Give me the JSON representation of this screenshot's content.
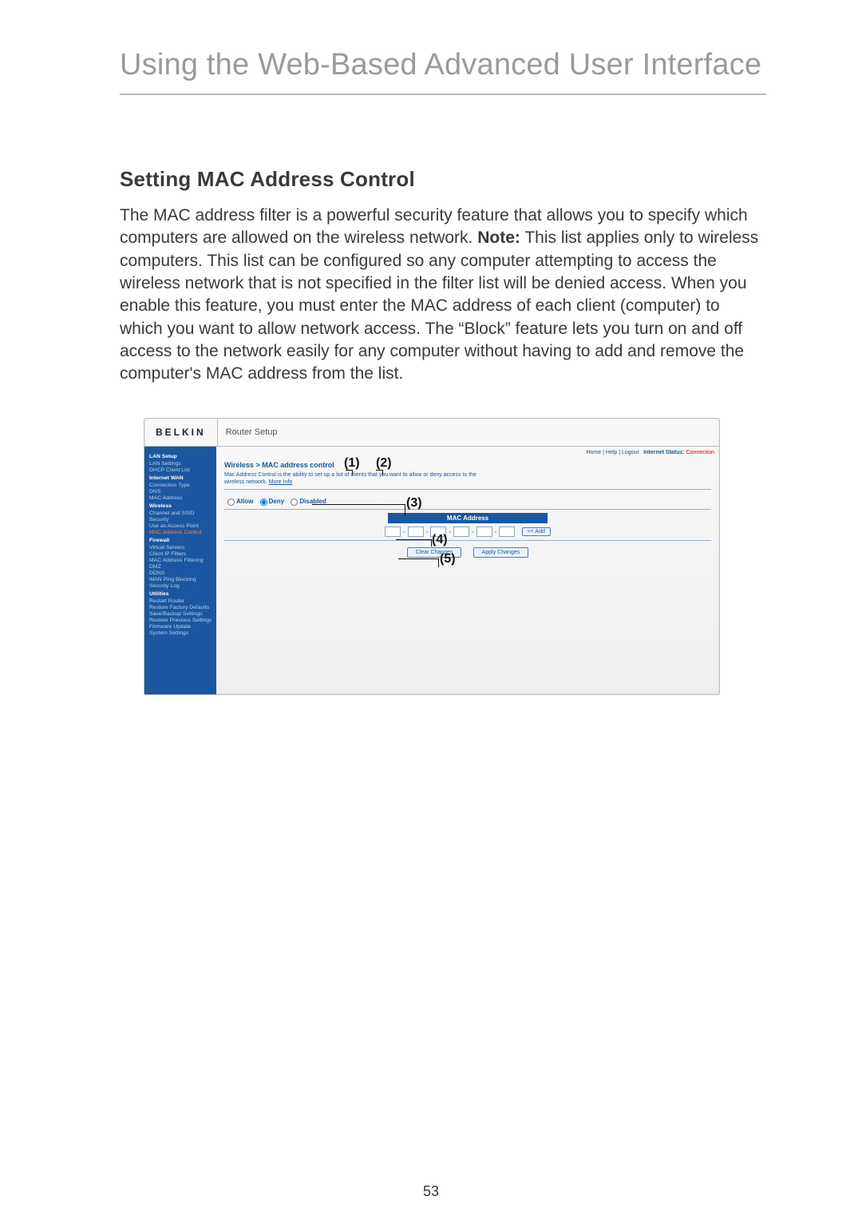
{
  "page": {
    "title": "Using the Web-Based Advanced User Interface",
    "section_title": "Setting MAC Address Control",
    "body_p1a": "The MAC address filter is a powerful security feature that allows you to specify which computers are allowed on the wireless network. ",
    "body_note_label": "Note:",
    "body_p1b": " This list applies only to wireless computers. This list can be configured so any computer attempting to access the wireless network that is not specified in the filter list will be denied access. When you enable this feature, you must enter the MAC address of each client (computer) to which you want to allow network access. The “Block” feature lets you turn on and off access to the network easily for any computer without having to add and remove the computer's MAC address from the list.",
    "number": "53"
  },
  "callouts": {
    "c1": "(1)",
    "c2": "(2)",
    "c3": "(3)",
    "c4": "(4)",
    "c5": "(5)"
  },
  "ui": {
    "logo": "BELKIN",
    "brand": "Router Setup",
    "toplinks": {
      "home": "Home",
      "help": "Help",
      "logout": "Logout",
      "status_label": "Internet Status:",
      "status_value": "Connection"
    },
    "sidebar": {
      "g1": "LAN Setup",
      "g1_items": [
        "LAN Settings",
        "DHCP Client List"
      ],
      "g2": "Internet WAN",
      "g2_items": [
        "Connection Type",
        "DNS",
        "MAC Address"
      ],
      "g3": "Wireless",
      "g3_items": [
        "Channel and SSID",
        "Security",
        "Use as Access Point"
      ],
      "g3_sel": "MAC Address Control",
      "g4": "Firewall",
      "g4_items": [
        "Virtual Servers",
        "Client IP Filters",
        "MAC Address Filtering",
        "DMZ",
        "DDNS",
        "WAN Ping Blocking",
        "Security Log"
      ],
      "g5": "Utilities",
      "g5_items": [
        "Restart Router",
        "Restore Factory Defaults",
        "Save/Backup Settings",
        "Restore Previous Settings",
        "Firmware Update",
        "System Settings"
      ]
    },
    "crumb": "Wireless > MAC address control",
    "desc": "Mac Address Control is the ability to set up a list of clients that you want to allow or deny access to the wireless network. ",
    "desc_more": "More Info",
    "radios": {
      "allow": "Allow",
      "deny": "Deny",
      "disabled": "Disabled"
    },
    "mac_header": "MAC Address",
    "add_btn": "<< Add",
    "clear_btn": "Clear Changes",
    "apply_btn": "Apply Changes"
  }
}
